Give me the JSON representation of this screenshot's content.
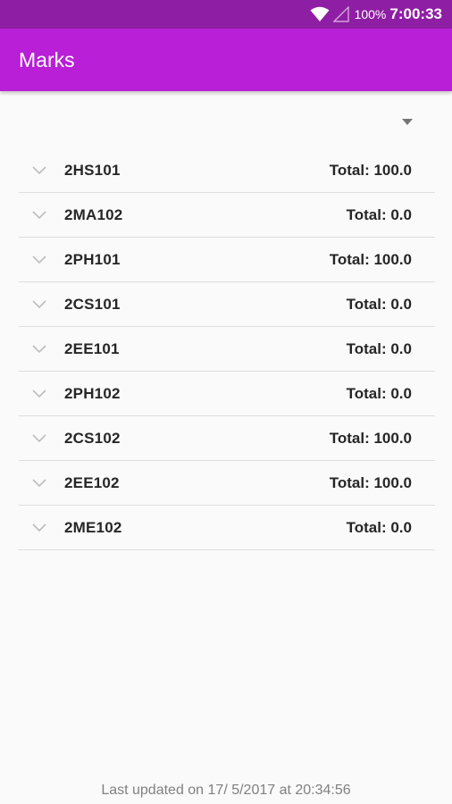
{
  "status_bar": {
    "battery": "100%",
    "time": "7:00:33",
    "wifi_icon": "wifi-icon",
    "signal_icon": "signal-icon"
  },
  "app_bar": {
    "title": "Marks"
  },
  "spinner": {
    "icon": "dropdown-arrow-icon"
  },
  "courses": [
    {
      "code": "2HS101",
      "total": "Total: 100.0"
    },
    {
      "code": "2MA102",
      "total": "Total: 0.0"
    },
    {
      "code": "2PH101",
      "total": "Total: 100.0"
    },
    {
      "code": "2CS101",
      "total": "Total: 0.0"
    },
    {
      "code": "2EE101",
      "total": "Total: 0.0"
    },
    {
      "code": "2PH102",
      "total": "Total: 0.0"
    },
    {
      "code": "2CS102",
      "total": "Total: 100.0"
    },
    {
      "code": "2EE102",
      "total": "Total: 100.0"
    },
    {
      "code": "2ME102",
      "total": "Total: 0.0"
    }
  ],
  "footer": {
    "last_updated": "Last updated on 17/ 5/2017 at 20:34:56"
  },
  "colors": {
    "status_bar": "#8e1ea3",
    "app_bar": "#b81fd6",
    "background": "#fafafa"
  }
}
